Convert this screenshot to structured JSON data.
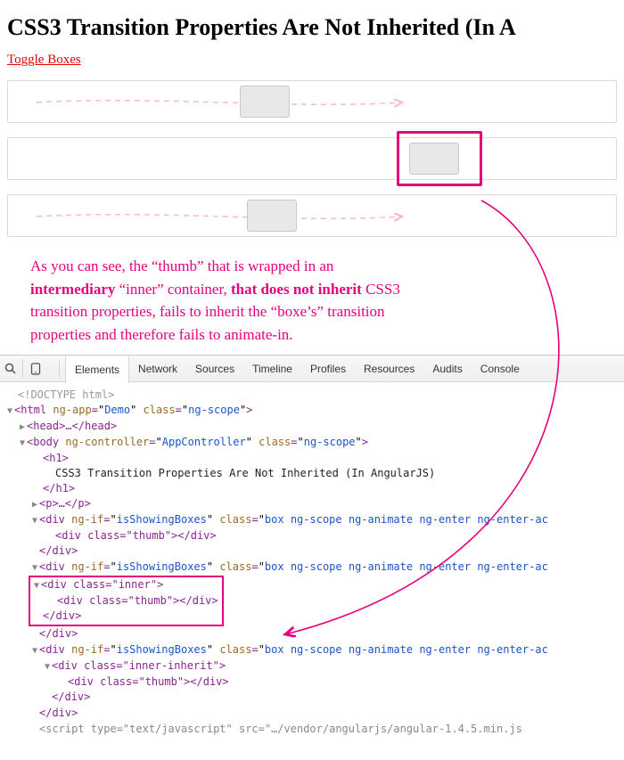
{
  "page": {
    "title": "CSS3 Transition Properties Are Not Inherited (In A",
    "toggle_label": "Toggle Boxes"
  },
  "annotation": {
    "l1a": "As you can see, the “thumb” that is wrapped in an ",
    "l2a": "intermediary",
    "l2b": " “inner” container, ",
    "l2c": "that does not inherit",
    "l2d": " CSS3 ",
    "l3": "transition properties, fails to inherit the “boxe’s” transition ",
    "l4": "properties and therefore fails to animate-in."
  },
  "devtools": {
    "tabs": [
      "Elements",
      "Network",
      "Sources",
      "Timeline",
      "Profiles",
      "Resources",
      "Audits",
      "Console"
    ],
    "active_tab_index": 0
  },
  "dom": {
    "doctype": "<!DOCTYPE html>",
    "html_open": "<html ",
    "html_ngapp_name": "ng-app",
    "html_ngapp_val": "Demo",
    "html_class_name": "class",
    "html_class_val": "ng-scope",
    "head": "<head>…</head>",
    "body_open": "<body ",
    "body_ctrl_name": "ng-controller",
    "body_ctrl_val": "AppController",
    "body_class_name": "class",
    "body_class_val": "ng-scope",
    "h1_open": "<h1>",
    "h1_text": "CSS3 Transition Properties Are Not Inherited (In AngularJS)",
    "h1_close": "</h1>",
    "p": "<p>…</p>",
    "div_ngif_name": "ng-if",
    "div_ngif_val": "isShowingBoxes",
    "div_class_name": "class",
    "div_class_val": "box ng-scope ng-animate ng-enter ng-enter-ac",
    "thumb_line": "<div class=\"thumb\"></div>",
    "div_close": "</div>",
    "inner_open": "<div class=\"inner\">",
    "inner_close": "</div>",
    "inner_inherit_open": "<div class=\"inner-inherit\">",
    "script_tail": "<script type=\"text/javascript\" src=\"…/vendor/angularjs/angular-1.4.5.min.js"
  }
}
